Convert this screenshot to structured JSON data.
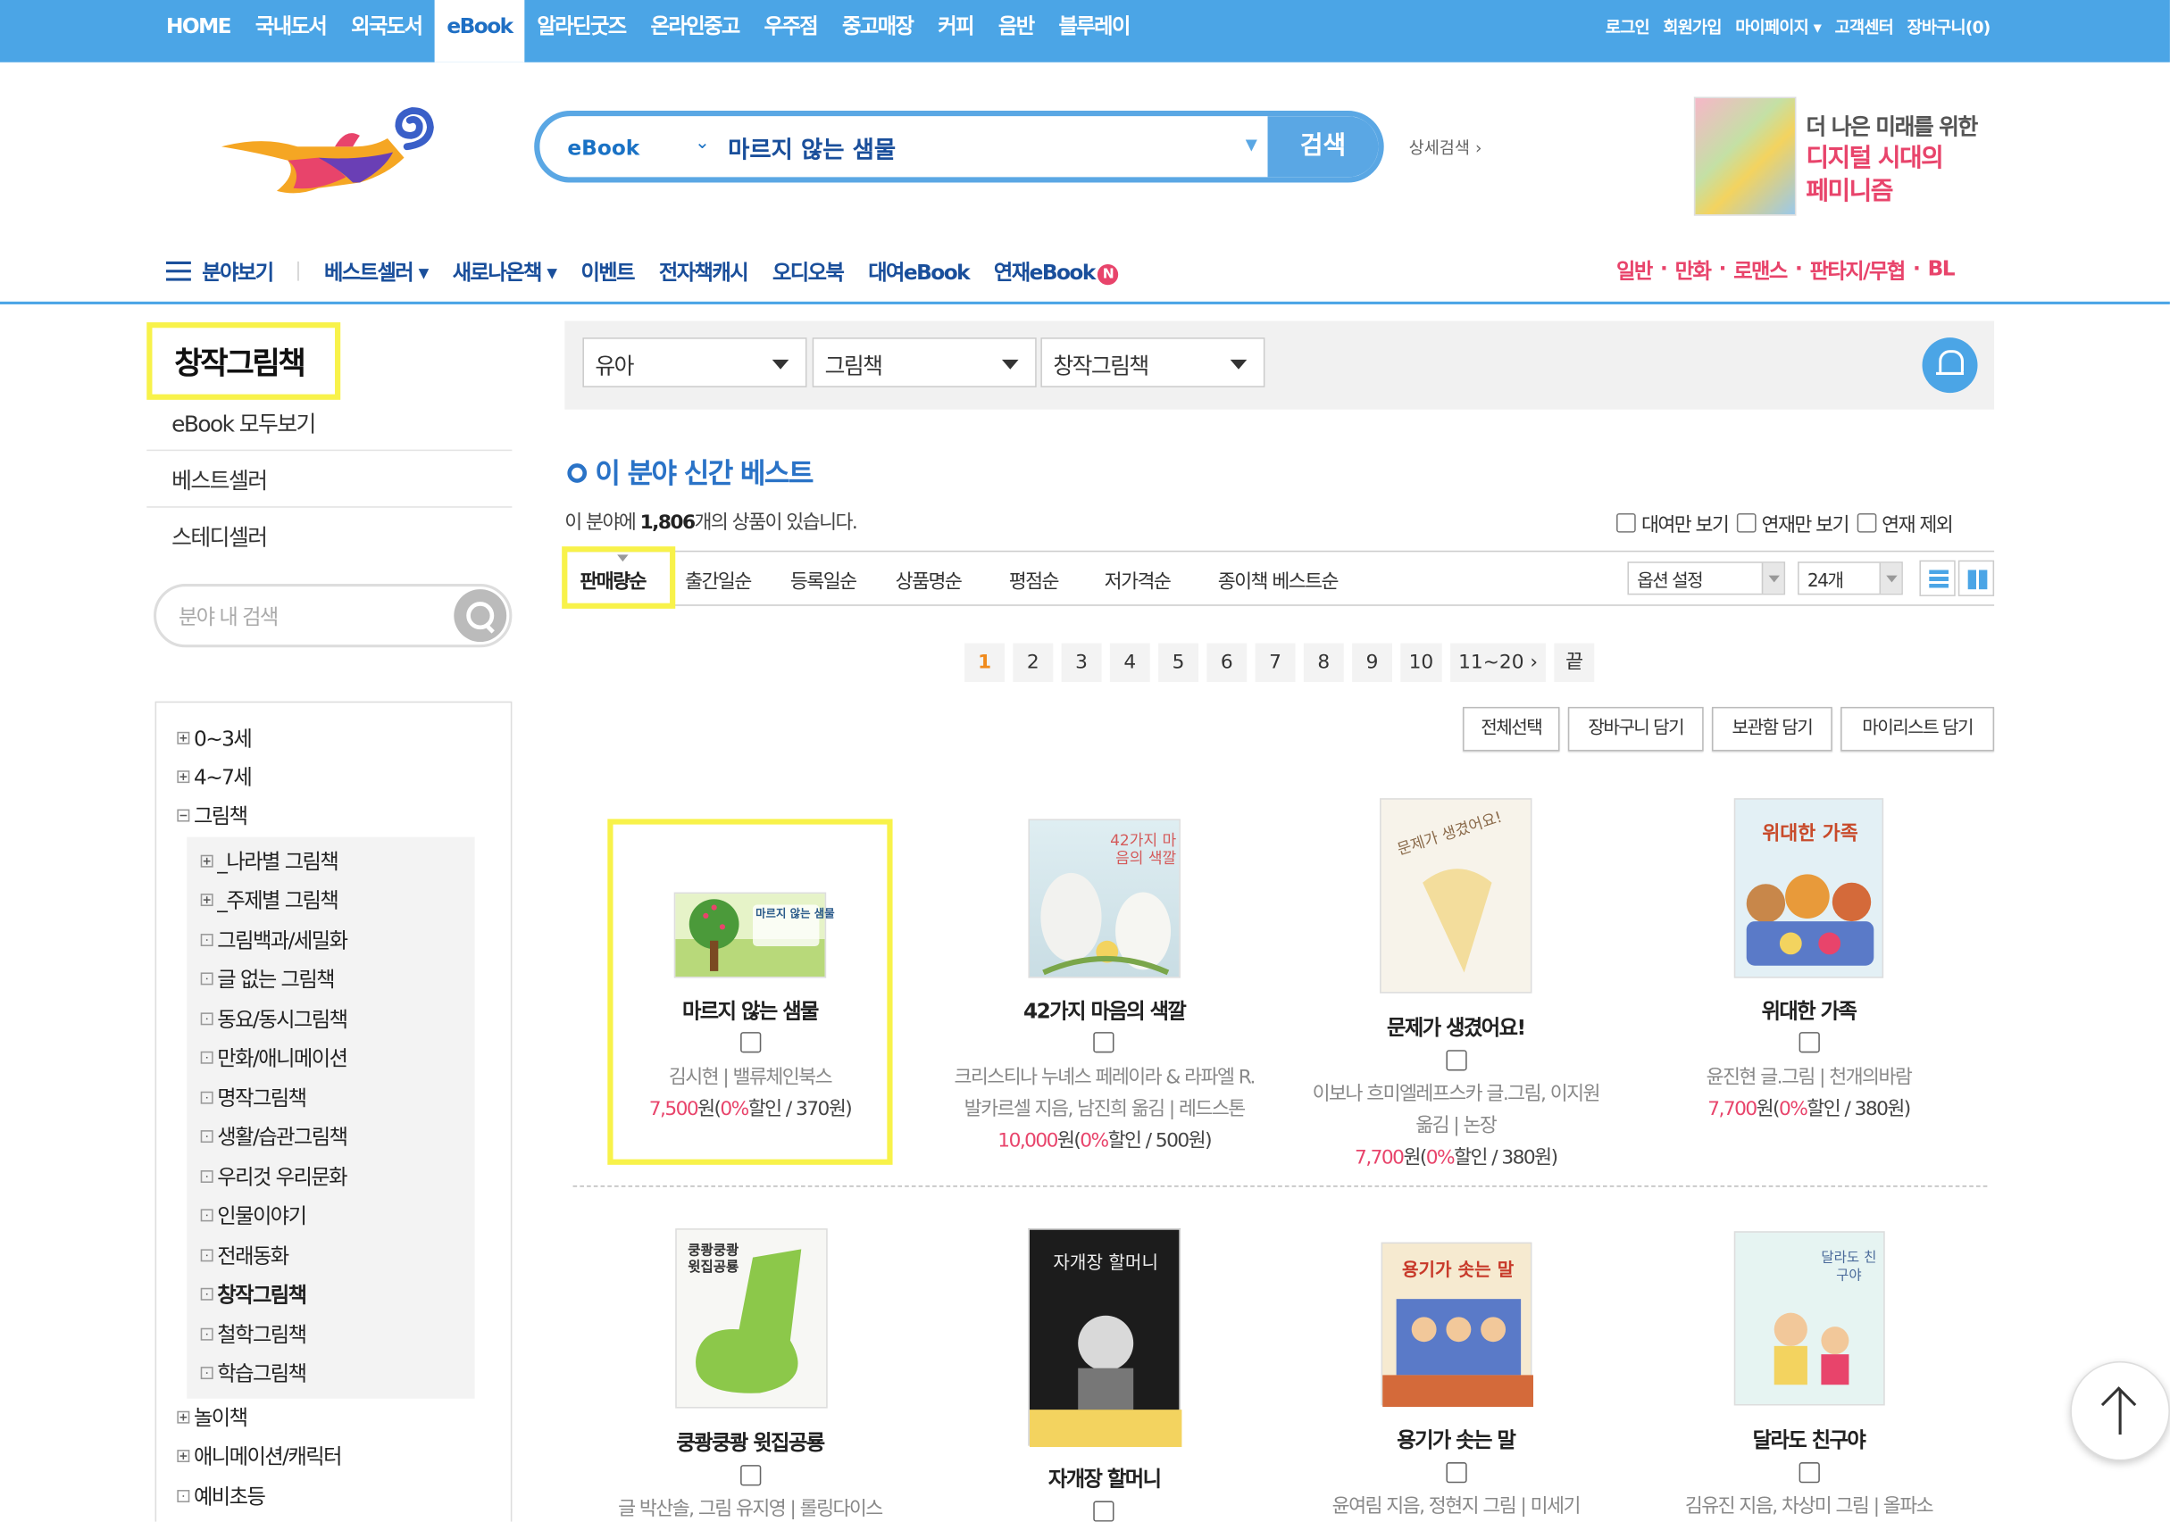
{
  "topnav": {
    "items": [
      "HOME",
      "국내도서",
      "외국도서",
      "eBook",
      "알라딘굿즈",
      "온라인중고",
      "우주점",
      "중고매장",
      "커피",
      "음반",
      "블루레이"
    ],
    "util": [
      "로그인",
      "회원가입",
      "마이페이지 ▾",
      "고객센터",
      "장바구니(0)"
    ]
  },
  "search": {
    "category": "eBook",
    "query": "마르지 않는 샘물",
    "button": "검색",
    "advanced": "상세검색 ›"
  },
  "ad": {
    "line1": "더 나은 미래를 위한",
    "line2": "디지털 시대의",
    "line3": "페미니즘"
  },
  "gnb": {
    "menu": "분야보기",
    "items": [
      "베스트셀러 ▾",
      "새로나온책 ▾",
      "이벤트",
      "전자책캐시",
      "오디오북",
      "대여eBook",
      "연재eBook"
    ],
    "new_badge": "N",
    "right": [
      "일반",
      "만화",
      "로맨스",
      "판타지/무협",
      "BL"
    ]
  },
  "left": {
    "title": "창작그림책",
    "links": [
      "eBook 모두보기",
      "베스트셀러",
      "스테디셀러"
    ],
    "search_placeholder": "분야 내 검색",
    "tree": {
      "top": [
        "0~3세",
        "4~7세",
        "그림책"
      ],
      "sub": [
        "_나라별 그림책",
        "_주제별 그림책",
        "그림백과/세밀화",
        "글 없는 그림책",
        "동요/동시그림책",
        "만화/애니메이션",
        "명작그림책",
        "생활/습관그림책",
        "우리것 우리문화",
        "인물이야기",
        "전래동화",
        "창작그림책",
        "철학그림책",
        "학습그림책"
      ],
      "bottom": [
        "놀이책",
        "애니메이션/캐릭터",
        "예비초등"
      ]
    }
  },
  "filters": [
    "유아",
    "그림책",
    "창작그림책"
  ],
  "section": {
    "title": "이 분야 신간 베스트",
    "count_prefix": "이 분야에 ",
    "count": "1,806",
    "count_suffix": "개의 상품이 있습니다."
  },
  "view_checks": [
    "대여만 보기",
    "연재만 보기",
    "연재 제외"
  ],
  "sort": {
    "active": "판매량순",
    "items": [
      "출간일순",
      "등록일순",
      "상품명순",
      "평점순",
      "저가격순",
      "종이책 베스트순"
    ],
    "option": "옵션 설정",
    "per_page": "24개"
  },
  "paging": [
    "1",
    "2",
    "3",
    "4",
    "5",
    "6",
    "7",
    "8",
    "9",
    "10",
    "11~20 ›",
    "끝"
  ],
  "actions": [
    "전체선택",
    "장바구니 담기",
    "보관함 담기",
    "마이리스트 담기"
  ],
  "products": [
    {
      "title": "마르지 않는 샘물",
      "author": "김시현 | 밸류체인북스",
      "author2": "",
      "price": "7,500",
      "discount": "0%",
      "point": "370원",
      "cover_text": "마르지 않는 샘물"
    },
    {
      "title": "42가지 마음의 색깔",
      "author": "크리스티나 누녜스 페레이라 & 라파엘 R.",
      "author2": "발카르셀 지음, 남진희 옮김 | 레드스톤",
      "price": "10,000",
      "discount": "0%",
      "point": "500원",
      "cover_text": "42가지 마음의 색깔"
    },
    {
      "title": "문제가 생겼어요!",
      "author": "이보나 흐미엘레프스카 글.그림, 이지원",
      "author2": "옮김 | 논장",
      "price": "7,700",
      "discount": "0%",
      "point": "380원",
      "cover_text": "문제가 생겼어요!"
    },
    {
      "title": "위대한 가족",
      "author": "윤진현 글.그림 | 천개의바람",
      "author2": "",
      "price": "7,700",
      "discount": "0%",
      "point": "380원",
      "cover_text": "위대한 가족"
    },
    {
      "title": "쿵쾅쿵쾅 윗집공룡",
      "author": "글 박산솔, 그림 유지영 | 롤링다이스",
      "cover_text": "쿵쾅쿵쾅 윗집공룡"
    },
    {
      "title": "자개장 할머니",
      "author": "",
      "cover_text": "자개장 할머니"
    },
    {
      "title": "용기가 솟는 말",
      "author": "윤여림 지음, 정현지 그림 | 미세기",
      "cover_text": "용기가 솟는 말"
    },
    {
      "title": "달라도 친구야",
      "author": "김유진 지음, 차상미 그림 | 올파소",
      "cover_text": "달라도 친구야"
    }
  ],
  "price_labels": {
    "won": "원(",
    "off": "할인 / ",
    "close": ")"
  },
  "colors": {
    "topbar": "#4ba5e6",
    "accent": "#2a73c7",
    "price": "#e8446b",
    "highlight": "#f8f24a"
  }
}
